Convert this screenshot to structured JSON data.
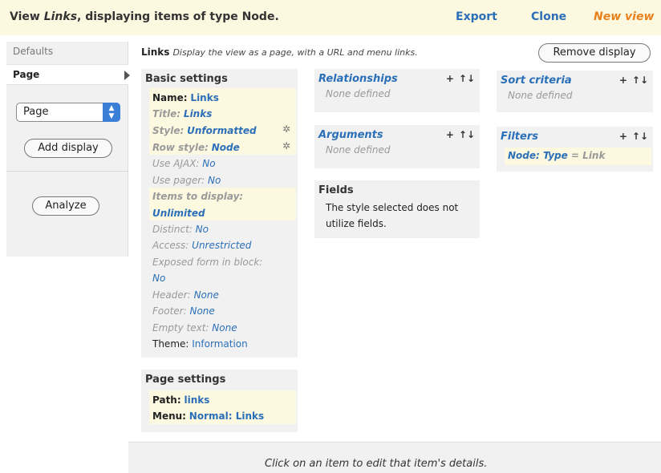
{
  "header": {
    "title_prefix": "View ",
    "view_name": "Links",
    "title_suffix": ", displaying items of type Node.",
    "export_label": "Export",
    "clone_label": "Clone",
    "new_view_label": "New view"
  },
  "sidebar": {
    "tab_defaults": "Defaults",
    "tab_page": "Page",
    "display_select_value": "Page",
    "add_display_label": "Add display",
    "analyze_label": "Analyze"
  },
  "display": {
    "name": "Links",
    "description": "Display the view as a page, with a URL and menu links.",
    "remove_label": "Remove display"
  },
  "basic_settings": {
    "heading": "Basic settings",
    "name_k": "Name:",
    "name_v": "Links",
    "title_k": "Title:",
    "title_v": "Links",
    "style_k": "Style:",
    "style_v": "Unformatted",
    "rowstyle_k": "Row style:",
    "rowstyle_v": "Node",
    "ajax_k": "Use AJAX:",
    "ajax_v": "No",
    "pager_k": "Use pager:",
    "pager_v": "No",
    "items_k": "Items to display:",
    "items_v": "Unlimited",
    "distinct_k": "Distinct:",
    "distinct_v": "No",
    "access_k": "Access:",
    "access_v": "Unrestricted",
    "exposed_k": "Exposed form in block:",
    "exposed_v": "No",
    "header_k": "Header:",
    "header_v": "None",
    "footer_k": "Footer:",
    "footer_v": "None",
    "empty_k": "Empty text:",
    "empty_v": "None",
    "theme_k": "Theme:",
    "theme_v": "Information"
  },
  "page_settings": {
    "heading": "Page settings",
    "path_k": "Path:",
    "path_v": "links",
    "menu_k": "Menu:",
    "menu_v": "Normal: Links"
  },
  "relationships": {
    "heading": "Relationships",
    "empty": "None defined"
  },
  "arguments": {
    "heading": "Arguments",
    "empty": "None defined"
  },
  "fields": {
    "heading": "Fields",
    "text": "The style selected does not utilize fields."
  },
  "sort_criteria": {
    "heading": "Sort criteria",
    "empty": "None defined"
  },
  "filters": {
    "heading": "Filters",
    "item_k": "Node: Type",
    "item_eq": " = ",
    "item_v": "Link"
  },
  "controls": {
    "add": "+",
    "rearrange": "↑↓",
    "gear": "✲"
  },
  "footer_message": "Click on an item to edit that item's details.",
  "colors": {
    "link": "#2a6fb8",
    "new_view": "#e8801a",
    "highlight_bg": "#fdf9e1",
    "panel_bg": "#f1f1f1"
  }
}
